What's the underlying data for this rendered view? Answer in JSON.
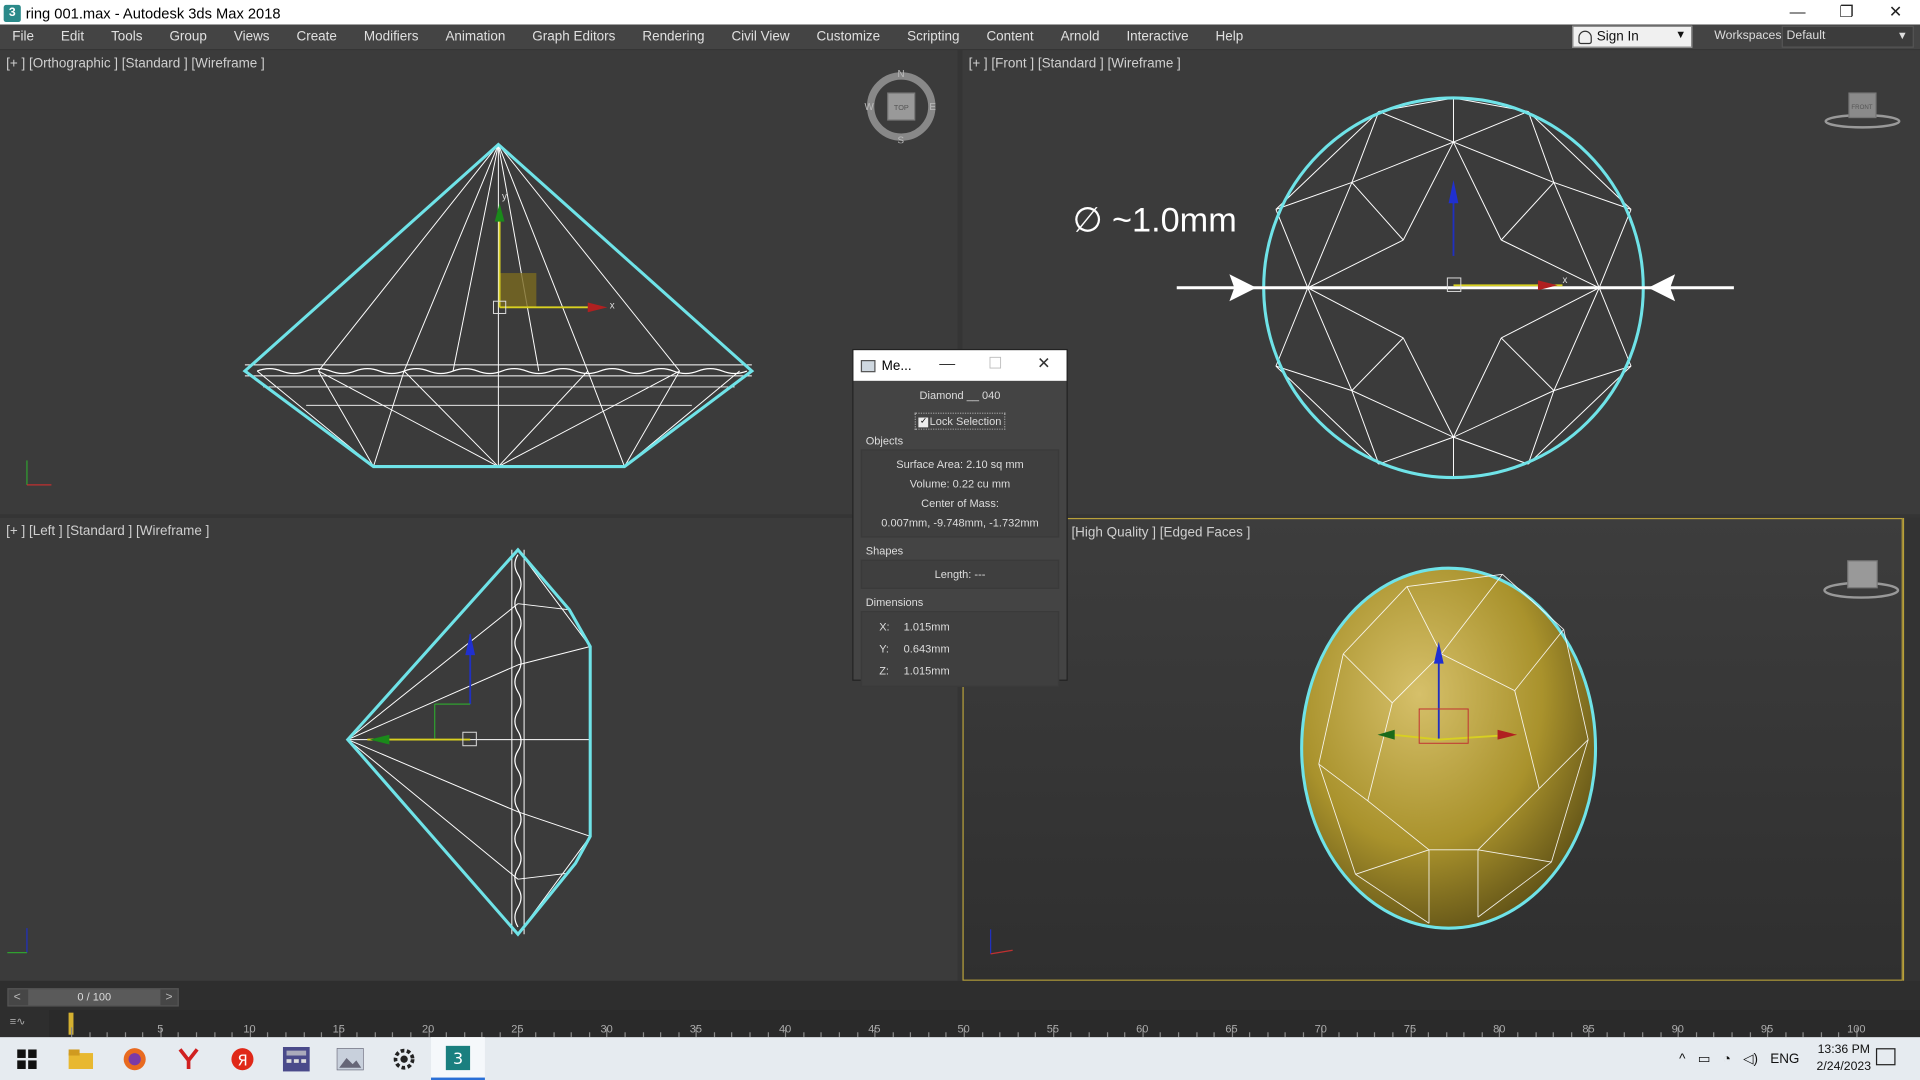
{
  "window": {
    "title": "ring 001.max - Autodesk 3ds Max 2018",
    "min": "—",
    "restore": "❐",
    "close": "✕"
  },
  "menu": [
    "File",
    "Edit",
    "Tools",
    "Group",
    "Views",
    "Create",
    "Modifiers",
    "Animation",
    "Graph Editors",
    "Rendering",
    "Civil View",
    "Customize",
    "Scripting",
    "Content",
    "Arnold",
    "Interactive",
    "Help"
  ],
  "signin": {
    "label": "Sign In"
  },
  "workspace": {
    "label": "Workspaces:",
    "value": "Default"
  },
  "viewports": {
    "top_left": {
      "label": "[+ ] [Orthographic ] [Standard ] [Wireframe ]"
    },
    "top_right": {
      "label": "[+ ] [Front ] [Standard ] [Wireframe ]",
      "annotation": "∅ ~1.0mm"
    },
    "bottom_left": {
      "label": "[+ ] [Left ] [Standard ] [Wireframe ]"
    },
    "bottom_right": {
      "label": "[High Quality ] [Edged Faces ]"
    }
  },
  "viewcube": {
    "top": "TOP",
    "front": "FRONT",
    "n": "N",
    "s": "S",
    "e": "E",
    "w": "W"
  },
  "measure_dialog": {
    "title": "Me...",
    "object_name": "Diamond __ 040",
    "lock_selection": "Lock Selection",
    "objects_title": "Objects",
    "surface_area": "Surface Area:  2.10 sq mm",
    "volume": "Volume:  0.22 cu mm",
    "center_of_mass_label": "Center of Mass:",
    "center_of_mass": "0.007mm, -9.748mm, -1.732mm",
    "shapes_title": "Shapes",
    "length": "Length:  ---",
    "dimensions_title": "Dimensions",
    "dims": [
      {
        "axis": "X:",
        "value": "1.015mm"
      },
      {
        "axis": "Y:",
        "value": "0.643mm"
      },
      {
        "axis": "Z:",
        "value": "1.015mm"
      }
    ]
  },
  "timeline": {
    "frame": "0 / 100",
    "ticks": [
      "5",
      "10",
      "15",
      "20",
      "25",
      "30",
      "35",
      "40",
      "45",
      "50",
      "55",
      "60",
      "65",
      "70",
      "75",
      "80",
      "85",
      "90",
      "95",
      "100"
    ]
  },
  "taskbar": {
    "lang": "ENG",
    "time": "13:36 PM",
    "date": "2/24/2023"
  },
  "colors": {
    "wire_select": "#6fe3e8",
    "gold": "#b39a2a",
    "viewport_bg": "#3b3b3b",
    "active_border": "#b8a03a"
  }
}
